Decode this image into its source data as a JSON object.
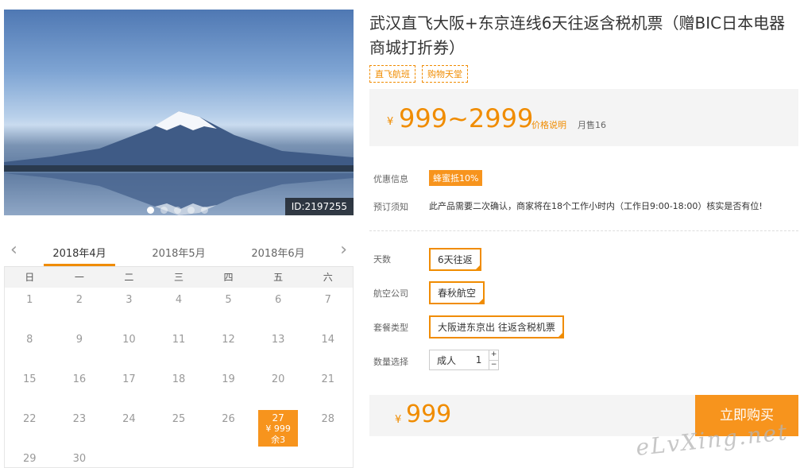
{
  "product": {
    "title": "武汉直飞大阪+东京连线6天往返含税机票（赠BIC日本电器商城打折券）",
    "tags": [
      "直飞航班",
      "购物天堂"
    ],
    "price_range": "999~2999",
    "currency": "¥",
    "price_explain": "价格说明",
    "sold": "月售16",
    "image_id": "ID:2197255",
    "carousel": {
      "count": 5,
      "active": 0
    }
  },
  "calendar": {
    "months": [
      "2018年4月",
      "2018年5月",
      "2018年6月"
    ],
    "active_month": 0,
    "weekdays": [
      "日",
      "一",
      "二",
      "三",
      "四",
      "五",
      "六"
    ],
    "leading_blanks": 0,
    "days": 30,
    "selected": {
      "day": "27",
      "price": "¥ 999",
      "remaining": "余3"
    }
  },
  "info": {
    "promo_label": "优惠信息",
    "promo": "蜂蜜抵10%",
    "notice_label": "预订须知",
    "notice": "此产品需要二次确认，商家将在18个工作小时内（工作日9:00-18:00）核实是否有位!"
  },
  "options": {
    "days_label": "天数",
    "days_value": "6天往返",
    "airline_label": "航空公司",
    "airline_value": "春秋航空",
    "package_label": "套餐类型",
    "package_value": "大阪进东京出 往返含税机票",
    "qty_label": "数量选择",
    "qty_type": "成人",
    "qty_value": "1",
    "plus": "+",
    "minus": "−"
  },
  "total": {
    "amount": "999",
    "currency": "¥"
  },
  "buy_label": "立即购买",
  "watermark": "eLvXing.net",
  "colors": {
    "accent": "#f08c00",
    "accent_fill": "#f7941d",
    "panel": "#f4f4f4"
  }
}
